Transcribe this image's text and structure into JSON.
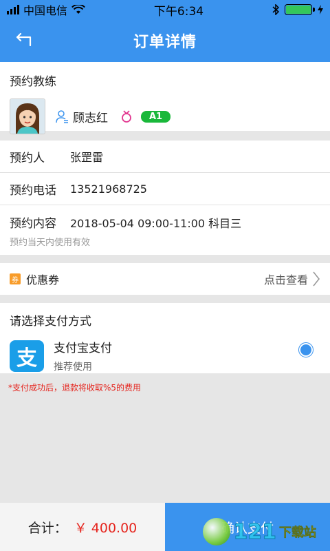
{
  "status_bar": {
    "carrier": "中国电信",
    "time": "下午6:34"
  },
  "navbar": {
    "title": "订单详情",
    "back_icon": "back-arrow-icon"
  },
  "coach": {
    "section_title": "预约教练",
    "name": "顾志红",
    "level": "A1",
    "gender_icon": "female-icon",
    "name_icon": "user-icon"
  },
  "booking": {
    "person_label": "预约人",
    "person_value": "张罡雷",
    "phone_label": "预约电话",
    "phone_value": "13521968725",
    "content_label": "预约内容",
    "content_value": "2018-05-04 09:00-11:00 科目三",
    "content_note": "预约当天内使用有效"
  },
  "coupon": {
    "icon_label": "券",
    "label": "优惠券",
    "action": "点击查看",
    "chevron_icon": "chevron-right-icon"
  },
  "payment": {
    "section_title": "请选择支付方式",
    "method_name": "支付宝支付",
    "method_sub": "推荐使用",
    "logo_glyph": "支",
    "selected": true
  },
  "refund_note": "*支付成功后，退款将收取%5的费用",
  "bottom": {
    "total_label": "合计：",
    "total_amount": "￥ 400.00",
    "pay_button_label": "确认支付"
  },
  "watermark": {
    "number": "121",
    "text": "下载站"
  },
  "colors": {
    "accent": "#3a93ee",
    "level_badge": "#19b83a",
    "warning": "#e5241d",
    "coupon_icon": "#f89c2a"
  }
}
